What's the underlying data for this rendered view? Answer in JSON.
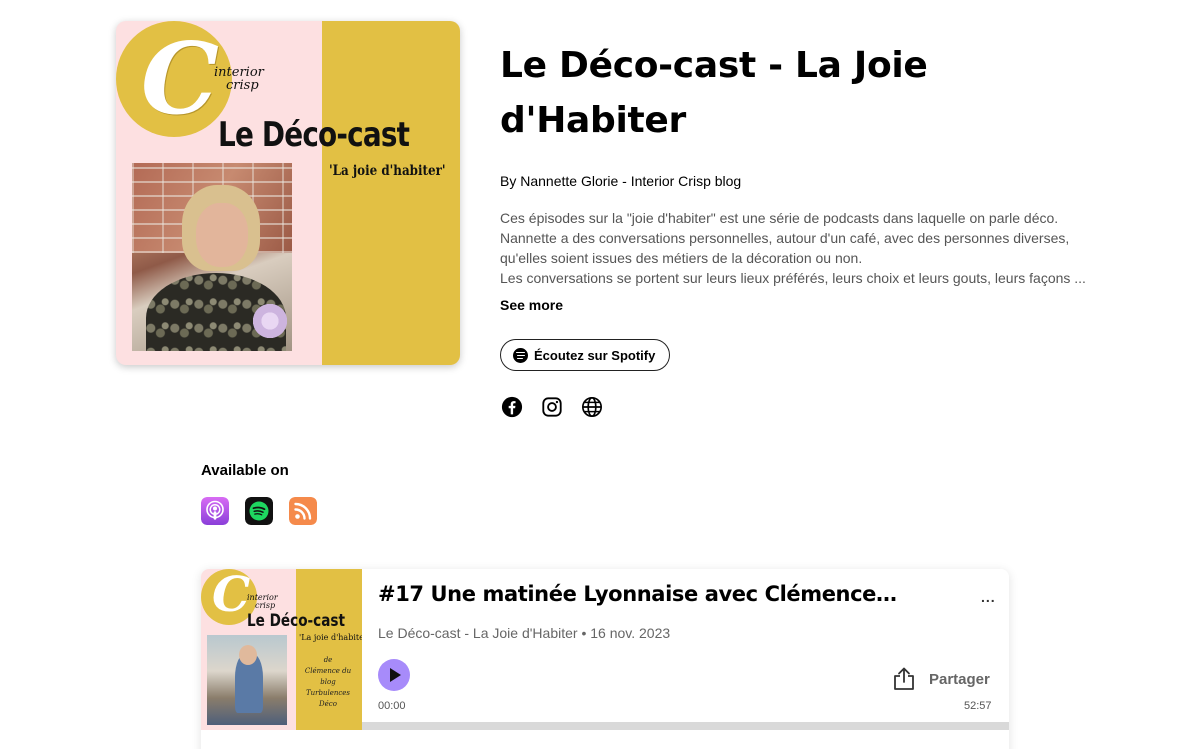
{
  "podcast": {
    "cover": {
      "brand_line1": "interior",
      "brand_line2": "crisp",
      "title": "Le Déco-cast",
      "subtitle": "'La joie d'habiter'"
    },
    "title": "Le Déco-cast - La Joie d'Habiter",
    "author": "By Nannette Glorie - Interior Crisp blog",
    "description": "Ces épisodes sur la \"joie d'habiter\" est une série de podcasts dans laquelle on parle déco.\nNannette a des conversations personnelles, autour d'un café, avec des personnes diverses,\nqu'elles soient issues des métiers de la décoration ou non.\n Les conversations se portent sur leurs lieux préférés, leurs choix et leurs gouts, leurs façons ...",
    "see_more": "See more",
    "spotify_button": "Écoutez sur Spotify",
    "social_icons": [
      "facebook-icon",
      "instagram-icon",
      "globe-icon"
    ]
  },
  "available_on": {
    "label": "Available on",
    "platforms": [
      {
        "name": "apple-podcasts-icon",
        "color": "#9b4fe0"
      },
      {
        "name": "spotify-icon",
        "color": "#1ed760"
      },
      {
        "name": "rss-icon",
        "color": "#f58a4b"
      }
    ]
  },
  "episode": {
    "art": {
      "brand_line1": "interior",
      "brand_line2": "crisp",
      "title": "Le Déco-cast",
      "subtitle": "'La joie d'habiter'",
      "guest": "de\nClémence du blog\nTurbulences Déco"
    },
    "title": "#17 Une matinée Lyonnaise avec Clémence d...",
    "more": "...",
    "show": "Le Déco-cast - La Joie d'Habiter",
    "date": "16 nov. 2023",
    "separator": "•",
    "share_label": "Partager",
    "time_current": "00:00",
    "time_total": "52:57",
    "progress": 0.0,
    "accent": "#a78bfa"
  }
}
